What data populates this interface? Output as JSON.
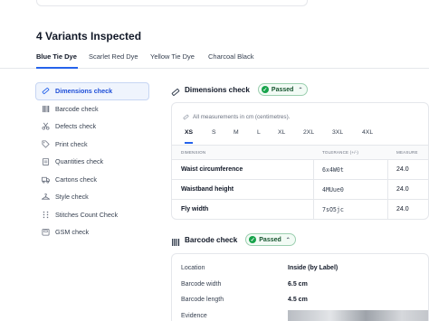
{
  "heading": "4 Variants Inspected",
  "variant_tabs": [
    "Blue Tie Dye",
    "Scarlet Red Dye",
    "Yellow Tie Dye",
    "Charcoal Black"
  ],
  "sidebar": {
    "items": [
      {
        "label": "Dimensions check",
        "icon": "ruler-icon"
      },
      {
        "label": "Barcode check",
        "icon": "barcode-icon"
      },
      {
        "label": "Defects check",
        "icon": "scissors-icon"
      },
      {
        "label": "Print check",
        "icon": "tag-icon"
      },
      {
        "label": "Quantities check",
        "icon": "clipboard-icon"
      },
      {
        "label": "Cartons check",
        "icon": "truck-icon"
      },
      {
        "label": "Style check",
        "icon": "hanger-icon"
      },
      {
        "label": "Stitches Count Check",
        "icon": "stitch-icon"
      },
      {
        "label": "GSM check",
        "icon": "scale-icon"
      }
    ]
  },
  "dimensions": {
    "title": "Dimensions check",
    "status": "Passed",
    "note": "All measurements in cm (centimetres).",
    "sizes": [
      "XS",
      "S",
      "M",
      "L",
      "XL",
      "2XL",
      "3XL",
      "4XL"
    ],
    "columns": {
      "dimension": "DIMENSION",
      "tolerance": "TOLERANCE (+/-)",
      "measure": "MEASURE"
    },
    "rows": [
      {
        "name": "Waist circumference",
        "tolerance": "6x4W0t",
        "measure": "24.0"
      },
      {
        "name": "Waistband height",
        "tolerance": "4MUue0",
        "measure": "24.0"
      },
      {
        "name": "Fly width",
        "tolerance": "7sO5jc",
        "measure": "24.0"
      }
    ]
  },
  "barcode": {
    "title": "Barcode check",
    "status": "Passed",
    "rows": [
      {
        "label": "Location",
        "value": "Inside (by Label)"
      },
      {
        "label": "Barcode width",
        "value": "6.5 cm"
      },
      {
        "label": "Barcode length",
        "value": "4.5 cm"
      },
      {
        "label": "Evidence",
        "value": ""
      }
    ]
  },
  "colors": {
    "accent": "#2563eb",
    "passed": "#16a34a"
  }
}
